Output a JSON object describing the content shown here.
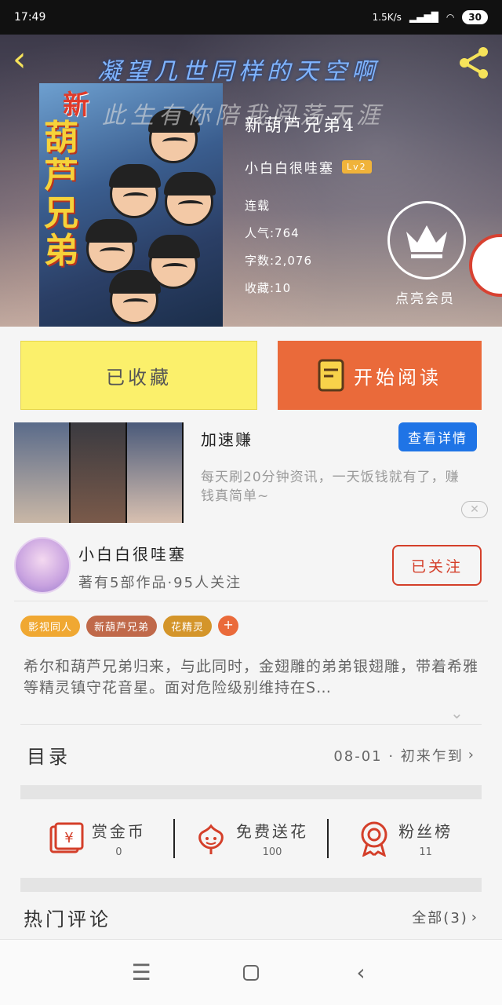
{
  "status_bar": {
    "time": "17:49",
    "speed": "1.5K/s",
    "battery": "30"
  },
  "hero": {
    "banner_line1": "凝望几世同样的天空啊",
    "banner_line2": "此生有你陪我阅荡天涯",
    "cover_title": "葫芦兄弟",
    "cover_new": "新",
    "book_title": "新葫芦兄弟4",
    "author": "小白白很哇塞",
    "level": "Lv2",
    "status": "连载",
    "popularity": "人气:764",
    "word_count": "字数:2,076",
    "favorites": "收藏:10",
    "vip_label": "点亮会员"
  },
  "actions": {
    "collected_label": "已收藏",
    "read_label": "开始阅读"
  },
  "ad": {
    "title": "加速赚",
    "button": "查看详情",
    "description": "每天刷20分钟资讯，一天饭钱就有了，赚钱真简单~",
    "close": "✕"
  },
  "author_card": {
    "name": "小白白很哇塞",
    "stats": "著有5部作品·95人关注",
    "follow_label": "已关注"
  },
  "tags": [
    {
      "label": "影视同人",
      "color": "#f0a832"
    },
    {
      "label": "新葫芦兄弟",
      "color": "#c0694a"
    },
    {
      "label": "花精灵",
      "color": "#d4952a"
    }
  ],
  "synopsis": "希尔和葫芦兄弟归来，与此同时，金翅雕的弟弟银翅雕，带着希雅等精灵镇守花音星。面对危险级别维持在S…",
  "toc": {
    "label": "目录",
    "latest": "08-01 · 初来乍到"
  },
  "stats": [
    {
      "label": "赏金币",
      "value": "0",
      "icon": "gift-coin-icon"
    },
    {
      "label": "免费送花",
      "value": "100",
      "icon": "flower-icon"
    },
    {
      "label": "粉丝榜",
      "value": "11",
      "icon": "medal-icon"
    }
  ],
  "comments": {
    "title": "热门评论",
    "all_label": "全部(3)"
  },
  "colors": {
    "accent_orange": "#ea6a3a",
    "accent_yellow": "#fbf06b",
    "link_blue": "#1f74e6",
    "follow_red": "#d43f2a"
  }
}
